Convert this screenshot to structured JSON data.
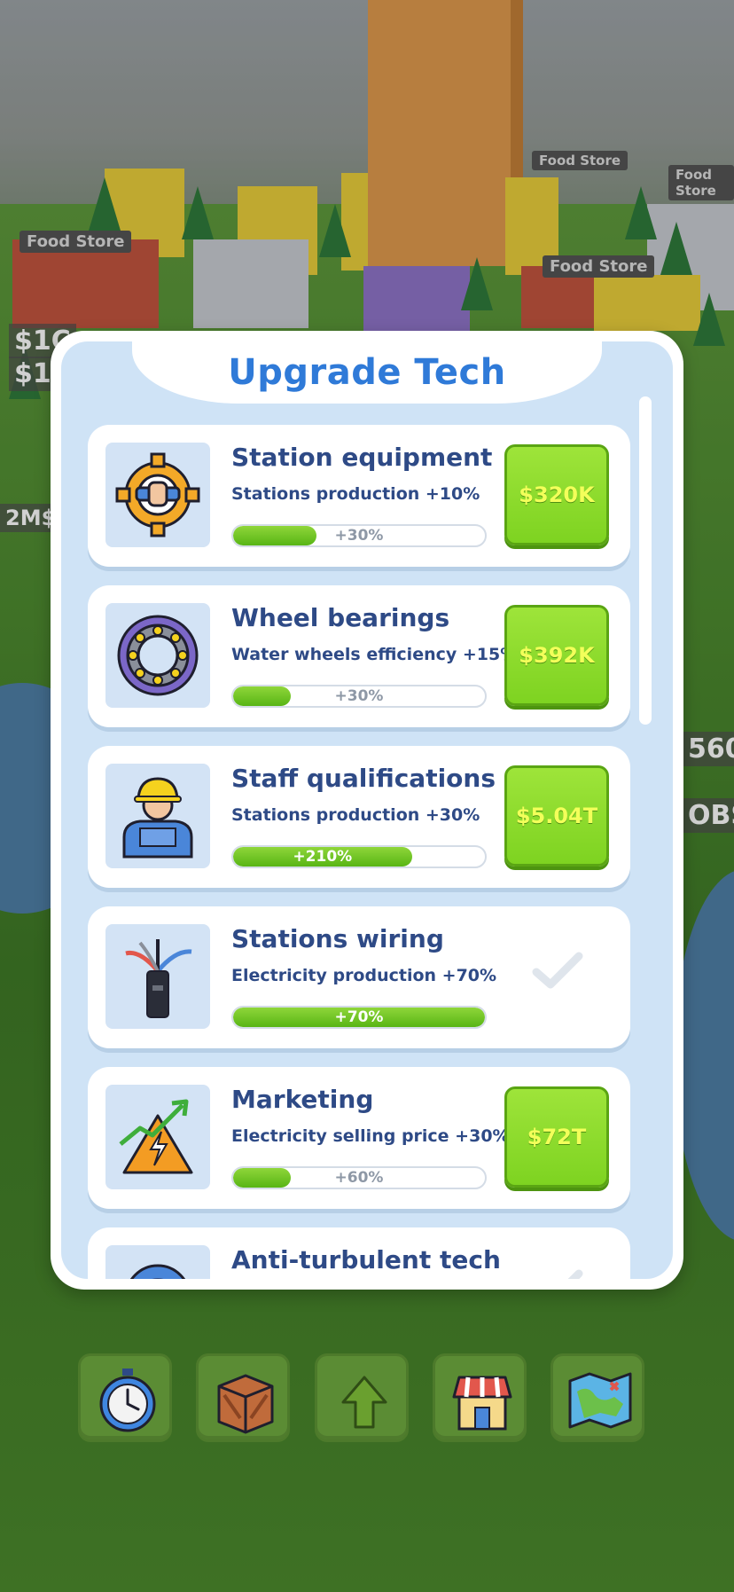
{
  "modal": {
    "title": "Upgrade Tech"
  },
  "upgrades": [
    {
      "title": "Station equipment",
      "description": "Stations production +10%",
      "progress_label": "+30%",
      "progress_fill": 0.33,
      "price": "$320K",
      "purchased": false,
      "icon": "gear-wrench-icon"
    },
    {
      "title": "Wheel bearings",
      "description": "Water wheels efficiency +15%",
      "progress_label": "+30%",
      "progress_fill": 0.23,
      "price": "$392K",
      "purchased": false,
      "icon": "bearing-icon"
    },
    {
      "title": "Staff qualifications",
      "description": "Stations production +30%",
      "progress_label": "+210%",
      "progress_fill": 0.71,
      "price": "$5.04T",
      "purchased": false,
      "icon": "worker-icon"
    },
    {
      "title": "Stations wiring",
      "description": "Electricity production +70%",
      "progress_label": "+70%",
      "progress_fill": 1.0,
      "price": "",
      "purchased": true,
      "icon": "cable-icon"
    },
    {
      "title": "Marketing",
      "description": "Electricity selling price +30%",
      "progress_label": "+60%",
      "progress_fill": 0.23,
      "price": "$72T",
      "purchased": false,
      "icon": "marketing-icon"
    },
    {
      "title": "Anti-turbulent tech",
      "description": "",
      "progress_label": "",
      "progress_fill": 0,
      "price": "",
      "purchased": true,
      "icon": "turbine-icon"
    }
  ],
  "background_labels": {
    "shop_sign_1": "Food Store",
    "shop_sign_2": "Food Store",
    "shop_sign_3": "Food Store",
    "shop_sign_4": "Food Store",
    "left_label_1": "$1C",
    "left_label_2": "$1",
    "left_label_3": "2M$",
    "right_label_1": "560",
    "right_label_2": "OBS"
  },
  "toolbar": [
    {
      "name": "stopwatch-icon"
    },
    {
      "name": "crate-icon"
    },
    {
      "name": "upgrade-arrow-icon"
    },
    {
      "name": "shop-icon"
    },
    {
      "name": "map-icon"
    }
  ],
  "colors": {
    "accent_blue": "#2f7ad8",
    "text_navy": "#2e4a86",
    "buy_green": "#7ed321",
    "price_yellow": "#f3ff5a",
    "panel_bg": "#cfe3f6"
  }
}
